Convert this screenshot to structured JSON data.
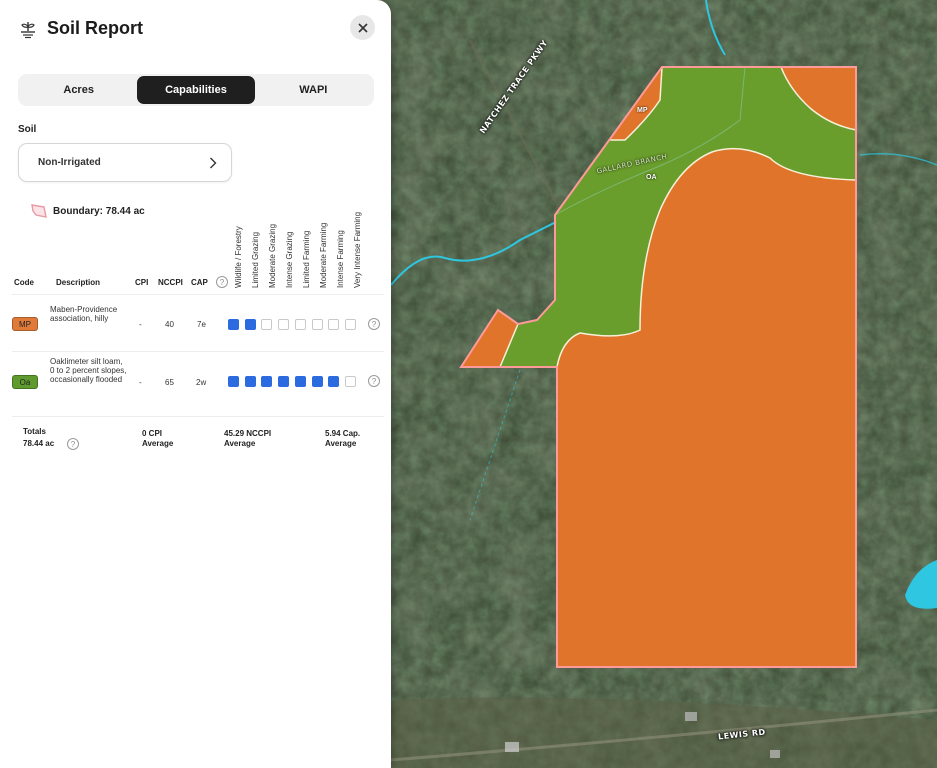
{
  "panel": {
    "title": "Soil Report",
    "tabs": [
      {
        "label": "Acres",
        "active": false
      },
      {
        "label": "Capabilities",
        "active": true
      },
      {
        "label": "WAPI",
        "active": false
      }
    ],
    "soil_label": "Soil",
    "soil_select": "Non-Irrigated",
    "boundary": "Boundary: 78.44 ac"
  },
  "table": {
    "headers": {
      "code": "Code",
      "description": "Description",
      "cpi": "CPI",
      "nccpi": "NCCPI",
      "cap": "CAP"
    },
    "capability_columns": [
      "Wildlife / Forestry",
      "Limited Grazing",
      "Moderate Grazing",
      "Intense Grazing",
      "Limited Farming",
      "Moderate Farming",
      "Intense Farming",
      "Very Intense Farming"
    ],
    "rows": [
      {
        "code": "MP",
        "color": "#e07a3a",
        "description": "Maben-Providence association, hilly",
        "cpi": "-",
        "nccpi": "40",
        "cap": "7e",
        "level": 2
      },
      {
        "code": "Oa",
        "color": "#5e9a2e",
        "description": "Oaklimeter silt loam, 0 to 2 percent slopes, occasionally flooded",
        "cpi": "-",
        "nccpi": "65",
        "cap": "2w",
        "level": 7
      }
    ],
    "totals": {
      "label": "Totals",
      "acres": "78.44 ac",
      "cpi": "0 CPI",
      "cpi_sub": "Average",
      "nccpi": "45.29 NCCPI",
      "nccpi_sub": "Average",
      "cap": "5.94 Cap.",
      "cap_sub": "Average"
    }
  },
  "map": {
    "labels": {
      "parkway": "NATCHEZ TRACE PKWY",
      "road": "LEWIS RD",
      "branch": "GALLARD BRANCH",
      "unit_mp": "MP",
      "unit_oa": "OA"
    },
    "colors": {
      "orange": "#e0742a",
      "green": "#6a9e2c",
      "boundary": "#ff8c8c",
      "water": "#2ec6e0"
    }
  }
}
